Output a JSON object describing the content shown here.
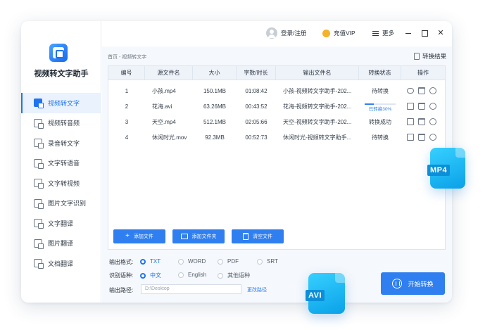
{
  "app": {
    "title": "视频转文字助手",
    "accent": "#2f7ff0"
  },
  "sidebar": {
    "items": [
      {
        "label": "视频转文字",
        "icon": "video-text-icon",
        "active": true
      },
      {
        "label": "视频转音频",
        "icon": "video-audio-icon"
      },
      {
        "label": "录音转文字",
        "icon": "recording-text-icon"
      },
      {
        "label": "文字转语音",
        "icon": "text-speech-icon"
      },
      {
        "label": "文字转视频",
        "icon": "text-video-icon"
      },
      {
        "label": "图片文字识别",
        "icon": "image-ocr-icon"
      },
      {
        "label": "文字翻译",
        "icon": "text-translate-icon"
      },
      {
        "label": "图片翻译",
        "icon": "image-translate-icon"
      },
      {
        "label": "文档翻译",
        "icon": "doc-translate-icon"
      }
    ]
  },
  "topbar": {
    "login_label": "登录/注册",
    "vip_label": "充值VIP",
    "more_label": "更多"
  },
  "breadcrumb": "首页 - 视频转文字",
  "result_label": "转换结果",
  "table": {
    "headers": [
      "编号",
      "源文件名",
      "大小",
      "字数/时长",
      "输出文件名",
      "转换状态",
      "操作"
    ],
    "rows": [
      {
        "no": "1",
        "name": "小孩.mp4",
        "size": "150.1MB",
        "duration": "01:08:42",
        "output": "小孩-视频转文字助手-202...",
        "status": "待转换"
      },
      {
        "no": "2",
        "name": "花海.avi",
        "size": "63.26MB",
        "duration": "00:43:52",
        "output": "花海-视频转文字助手-202...",
        "status": "已转换30%",
        "progress": 0.3
      },
      {
        "no": "3",
        "name": "天空.mp4",
        "size": "512.1MB",
        "duration": "02:05:66",
        "output": "天空-视频转文字助手-202...",
        "status": "转换成功"
      },
      {
        "no": "4",
        "name": "休闲时光.mov",
        "size": "92.3MB",
        "duration": "00:52:73",
        "output": "休闲时光-视频转文字助手...",
        "status": "待转换"
      }
    ]
  },
  "buttons": {
    "add_file": "添加文件",
    "add_folder": "添加文件夹",
    "clear_file": "清空文件",
    "start": "开始转换"
  },
  "options": {
    "format_label": "输出格式:",
    "formats": [
      "TXT",
      "WORD",
      "PDF",
      "SRT"
    ],
    "language_label": "识别语种:",
    "languages": [
      "中文",
      "English",
      "其他语种"
    ],
    "path_label": "输出路径:",
    "path_value": "D:\\Desktop",
    "change_path": "更改路径"
  },
  "badges": {
    "mp4": "MP4",
    "avi": "AVI"
  }
}
